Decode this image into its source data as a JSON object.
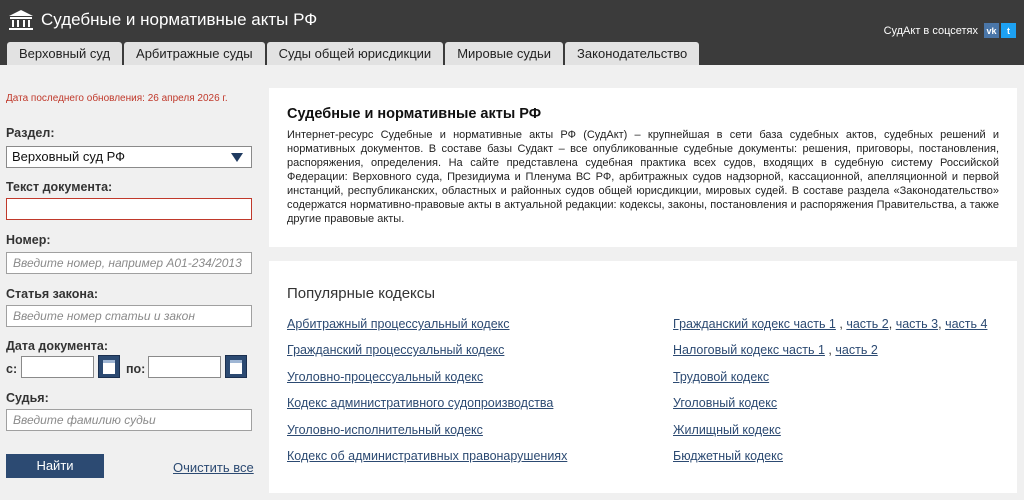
{
  "header": {
    "site_title": "Судебные и нормативные акты РФ",
    "social_label": "СудАкт в соцсетях",
    "social_vk": "vk",
    "social_tw": "t"
  },
  "tabs": [
    "Верховный суд",
    "Арбитражные суды",
    "Суды общей юрисдикции",
    "Мировые судьи",
    "Законодательство"
  ],
  "sidebar": {
    "update_text": "Дата последнего обновления: 26 апреля 2026 г.",
    "section_label": "Раздел:",
    "section_value": "Верховный суд РФ",
    "text_label": "Текст документа:",
    "text_value": "",
    "number_label": "Номер:",
    "number_placeholder": "Введите номер, например А01-234/2013",
    "article_label": "Статья закона:",
    "article_placeholder": "Введите номер статьи и закон",
    "date_label": "Дата документа:",
    "date_from_label": "с:",
    "date_to_label": "по:",
    "judge_label": "Судья:",
    "judge_placeholder": "Введите фамилию судьи",
    "find_button": "Найти",
    "clear_link": "Очистить все"
  },
  "about": {
    "title": "Судебные и нормативные акты РФ",
    "text": "Интернет-ресурс Судебные и нормативные акты РФ (СудАкт) – крупнейшая в сети база судебных актов, судебных решений и нормативных документов. В составе базы Судакт – все опубликованные судебные документы: решения, приговоры, постановления, распоряжения, определения. На сайте представлена судебная практика всех судов, входящих в судебную систему Российской Федерации: Верховного суда, Президиума и Пленума ВС РФ, арбитражных судов надзорной, кассационной, апелляционной и первой инстанций, республиканских, областных и районных судов общей юрисдикции, мировых судей. В составе раздела «Законодательство» содержатся нормативно-правовые акты в актуальной редакции: кодексы, законы, постановления и распоряжения Правительства, а также другие правовые акты."
  },
  "codes": {
    "title": "Популярные кодексы",
    "left": [
      "Арбитражный процессуальный кодекс",
      "Гражданский процессуальный кодекс",
      "Уголовно-процессуальный кодекс",
      "Кодекс административного судопроизводства",
      "Уголовно-исполнительный кодекс",
      "Кодекс об административных правонарушениях"
    ],
    "civil": {
      "part1": "Гражданский кодекс часть 1",
      "part2": "часть 2",
      "part3": "часть 3",
      "part4": "часть 4",
      "sep": ","
    },
    "tax": {
      "part1": "Налоговый кодекс часть 1",
      "part2": "часть 2"
    },
    "right": [
      "Трудовой кодекс",
      "Уголовный кодекс",
      "Жилищный кодекс",
      "Бюджетный кодекс"
    ]
  }
}
